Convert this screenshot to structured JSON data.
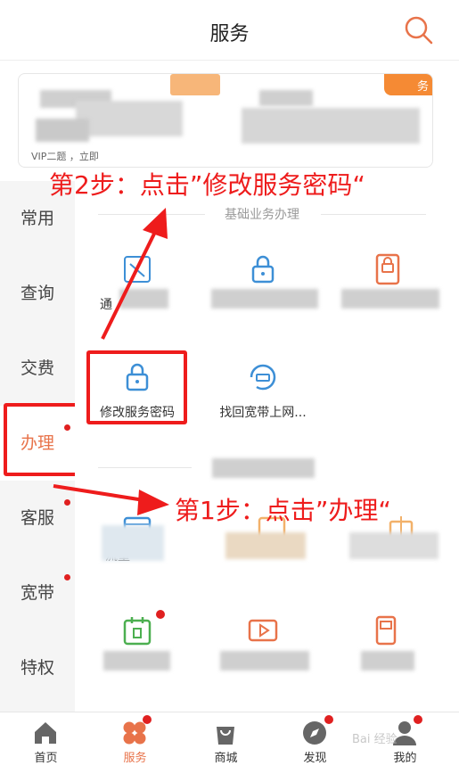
{
  "header": {
    "title": "服务"
  },
  "card": {
    "tag_right": "务",
    "foot_text": "VIP二题  ，立即"
  },
  "sidebar": {
    "items": [
      {
        "label": "常用",
        "dot": false
      },
      {
        "label": "查询",
        "dot": false
      },
      {
        "label": "交费",
        "dot": false
      },
      {
        "label": "办理",
        "dot": true,
        "active": true
      },
      {
        "label": "客服",
        "dot": true
      },
      {
        "label": "宽带",
        "dot": true
      },
      {
        "label": "特权",
        "dot": false
      }
    ]
  },
  "section": {
    "title": "基础业务办理"
  },
  "tiles": [
    {
      "label": "通"
    },
    {
      "label": "修改服务密码"
    },
    {
      "label": "找回宽带上网..."
    },
    {
      "label": "流量"
    }
  ],
  "annotations": {
    "step2": "第2步：点击”修改服务密码“",
    "step1": "第1步：点击”办理“"
  },
  "tabbar": {
    "items": [
      {
        "label": "首页",
        "icon": "home-icon"
      },
      {
        "label": "服务",
        "icon": "service-icon",
        "active": true,
        "dot": true
      },
      {
        "label": "商城",
        "icon": "shop-bag-icon"
      },
      {
        "label": "发现",
        "icon": "compass-icon",
        "dot": true
      },
      {
        "label": "我的",
        "icon": "user-icon",
        "dot": true
      }
    ]
  },
  "watermark": "Bai 经验",
  "colors": {
    "accent": "#e8734a",
    "annotation_red": "#ee1c1c",
    "icon_blue": "#3d8fd6",
    "icon_orange": "#e8734a",
    "icon_green": "#4caf50",
    "dot_red": "#e02020"
  }
}
